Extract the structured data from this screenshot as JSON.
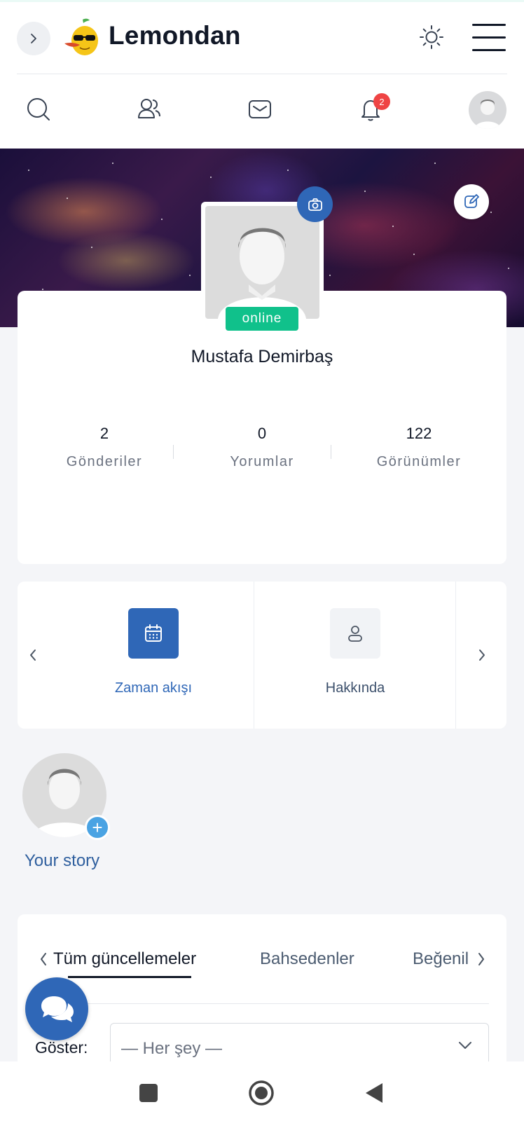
{
  "header": {
    "brand": "Lemondan",
    "icons": [
      "chevron-right-icon",
      "lemon-logo",
      "sun-icon",
      "hamburger-menu-icon"
    ]
  },
  "iconbar": {
    "icons": [
      "search-icon",
      "users-icon",
      "mail-icon",
      "bell-icon",
      "avatar"
    ],
    "notification_count": "2"
  },
  "profile": {
    "status": "online",
    "name": "Mustafa Demirbaş",
    "stats": [
      {
        "value": "2",
        "label": "Gönderiler"
      },
      {
        "value": "0",
        "label": "Yorumlar"
      },
      {
        "value": "122",
        "label": "Görünümler"
      }
    ]
  },
  "profile_tabs": {
    "items": [
      {
        "label": "Zaman akışı",
        "icon": "calendar-icon",
        "active": true
      },
      {
        "label": "Hakkında",
        "icon": "user-icon",
        "active": false
      }
    ]
  },
  "story": {
    "label": "Your story"
  },
  "feed": {
    "tabs": [
      "Tüm güncellemeler",
      "Bahsedenler",
      "Beğenil"
    ],
    "filter_label": "Göster:",
    "filter_value": "— Her şey —"
  },
  "colors": {
    "primary": "#2f67b7",
    "online": "#10c18b",
    "badge": "#ef4444"
  }
}
